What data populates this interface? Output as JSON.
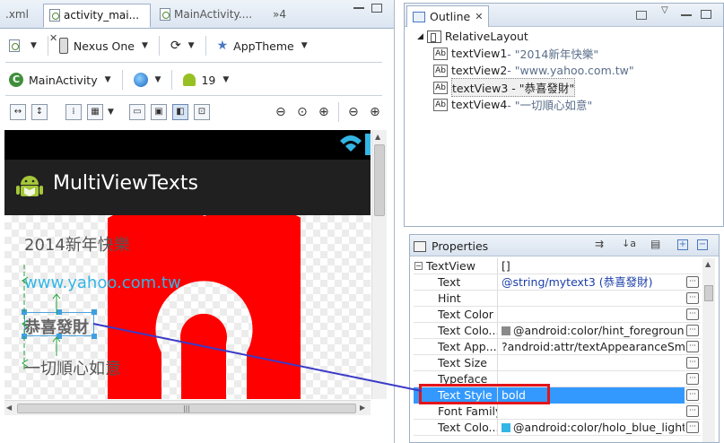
{
  "editor": {
    "tabs": [
      {
        "label": ".xml"
      },
      {
        "label": "activity_mai..."
      },
      {
        "label": "MainActivity...."
      },
      {
        "label": "»4"
      }
    ],
    "toolbar1": {
      "device": "Nexus One",
      "theme": "AppTheme"
    },
    "toolbar2": {
      "activity": "MainActivity",
      "api_level": "19"
    }
  },
  "preview": {
    "app_title": "MultiViewTexts",
    "textviews": [
      "2014新年快樂",
      "www.yahoo.com.tw",
      "恭喜發財",
      "一切順心如意"
    ]
  },
  "outline": {
    "title": "Outline",
    "root": "RelativeLayout",
    "children": [
      {
        "name": "textView1",
        "desc": " - \"2014新年快樂\""
      },
      {
        "name": "textView2",
        "desc": " - \"www.yahoo.com.tw\""
      },
      {
        "name": "textView3",
        "desc": " - \"恭喜發財\""
      },
      {
        "name": "textView4",
        "desc": " - \"一切順心如意\""
      }
    ]
  },
  "properties": {
    "title": "Properties",
    "rows": [
      {
        "name": "TextView",
        "value": "[]"
      },
      {
        "name": "Text",
        "value": "@string/mytext3 (恭喜發財)"
      },
      {
        "name": "Hint",
        "value": ""
      },
      {
        "name": "Text Color",
        "value": ""
      },
      {
        "name": "Text Colo...",
        "value": "@android:color/hint_foreground..."
      },
      {
        "name": "Text App...",
        "value": "?android:attr/textAppearanceSmall ..."
      },
      {
        "name": "Text Size",
        "value": ""
      },
      {
        "name": "Typeface",
        "value": ""
      },
      {
        "name": "Text Style",
        "value": "bold"
      },
      {
        "name": "Font Family",
        "value": ""
      },
      {
        "name": "Text Colo...",
        "value": "@android:color/holo_blue_light"
      }
    ]
  },
  "colors": {
    "selection": "#3399ff",
    "highlight": "#e3151a",
    "link_text": "#33b5e5",
    "connector": "#3a3ac8"
  }
}
